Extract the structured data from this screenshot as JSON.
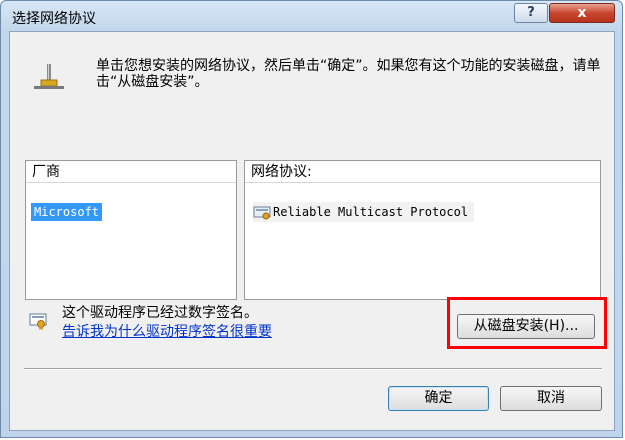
{
  "window": {
    "title": "选择网络协议",
    "help_label": "?",
    "close_label": "x"
  },
  "instruction": "单击您想安装的网络协议，然后单击“确定”。如果您有这个功能的安装磁盘，请单击“从磁盘安装”。",
  "vendors": {
    "header": "厂商",
    "items": [
      "Microsoft"
    ]
  },
  "protocols": {
    "header": "网络协议:",
    "items": [
      "Reliable Multicast Protocol"
    ]
  },
  "signature": {
    "text": "这个驱动程序已经过数字签名。",
    "link": "告诉我为什么驱动程序签名很重要"
  },
  "buttons": {
    "have_disk": "从磁盘安装(H)...",
    "ok": "确定",
    "cancel": "取消"
  },
  "colors": {
    "selection": "#3399ff",
    "highlight": "#ff0000",
    "link": "#0033cc"
  }
}
